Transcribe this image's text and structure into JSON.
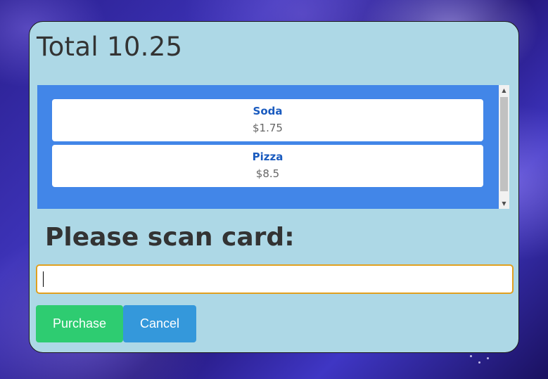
{
  "total": {
    "label": "Total 10.25"
  },
  "cart": {
    "items": [
      {
        "name": "Soda",
        "price": "$1.75"
      },
      {
        "name": "Pizza",
        "price": "$8.5"
      }
    ]
  },
  "scan": {
    "label": "Please scan card:",
    "input_value": "",
    "input_placeholder": ""
  },
  "actions": {
    "purchase_label": "Purchase",
    "cancel_label": "Cancel"
  },
  "colors": {
    "dialog_background": "#add8e6",
    "cart_background": "#4286e8",
    "item_name": "#1a5bbf",
    "purchase_button": "#2ecc71",
    "cancel_button": "#3498db",
    "input_focus_border": "#e0a020"
  },
  "icons": {
    "scroll_up": "scroll-up-arrow-icon",
    "scroll_down": "scroll-down-arrow-icon"
  }
}
